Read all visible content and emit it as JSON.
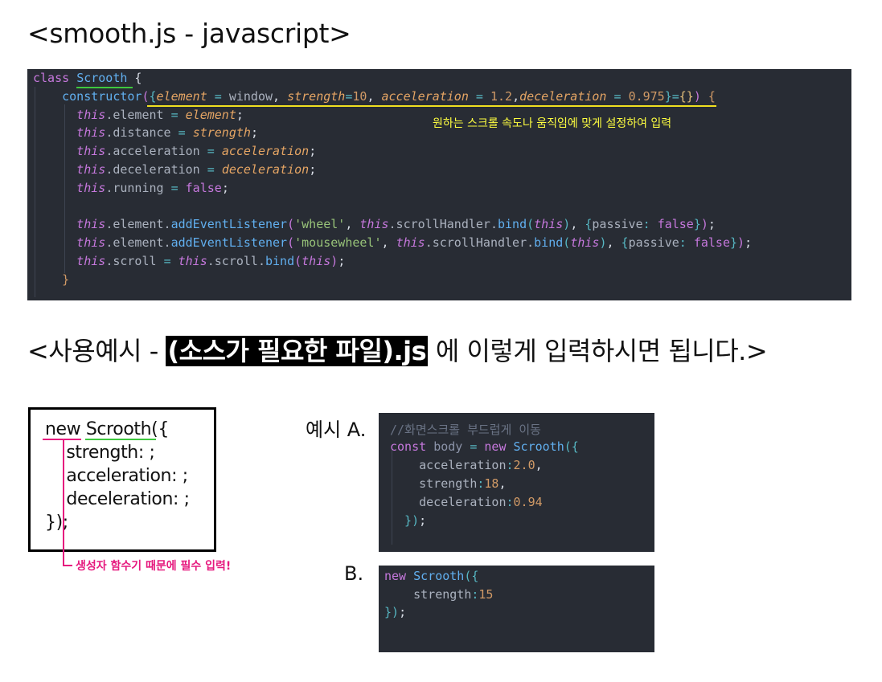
{
  "title": "<smooth.js - javascript>",
  "main_code": {
    "lines": [
      [
        {
          "t": "class ",
          "c": "kw"
        },
        {
          "t": "Scrooth",
          "c": "cls"
        },
        {
          "t": " {",
          "c": "white"
        }
      ],
      [
        {
          "t": "    constructor",
          "c": "fn"
        },
        {
          "t": "(",
          "c": "br2"
        },
        {
          "t": "{",
          "c": "br3"
        },
        {
          "t": "element",
          "c": "par"
        },
        {
          "t": " = ",
          "c": "op"
        },
        {
          "t": "window",
          "c": "prop"
        },
        {
          "t": ", ",
          "c": "white"
        },
        {
          "t": "strength",
          "c": "par"
        },
        {
          "t": "=",
          "c": "op"
        },
        {
          "t": "10",
          "c": "num"
        },
        {
          "t": ", ",
          "c": "white"
        },
        {
          "t": "acceleration",
          "c": "par"
        },
        {
          "t": " = ",
          "c": "op"
        },
        {
          "t": "1.2",
          "c": "num"
        },
        {
          "t": ",",
          "c": "white"
        },
        {
          "t": "deceleration",
          "c": "par"
        },
        {
          "t": " = ",
          "c": "op"
        },
        {
          "t": "0.975",
          "c": "num"
        },
        {
          "t": "}",
          "c": "br3"
        },
        {
          "t": "=",
          "c": "op"
        },
        {
          "t": "{}",
          "c": "bry"
        },
        {
          "t": ")",
          "c": "br2"
        },
        {
          "t": " {",
          "c": "br1"
        }
      ],
      [
        {
          "t": "      this",
          "c": "this"
        },
        {
          "t": ".element ",
          "c": "prop"
        },
        {
          "t": "= ",
          "c": "op"
        },
        {
          "t": "element",
          "c": "par"
        },
        {
          "t": ";",
          "c": "white"
        }
      ],
      [
        {
          "t": "      this",
          "c": "this"
        },
        {
          "t": ".distance ",
          "c": "prop"
        },
        {
          "t": "= ",
          "c": "op"
        },
        {
          "t": "strength",
          "c": "par"
        },
        {
          "t": ";",
          "c": "white"
        }
      ],
      [
        {
          "t": "      this",
          "c": "this"
        },
        {
          "t": ".acceleration ",
          "c": "prop"
        },
        {
          "t": "= ",
          "c": "op"
        },
        {
          "t": "acceleration",
          "c": "par"
        },
        {
          "t": ";",
          "c": "white"
        }
      ],
      [
        {
          "t": "      this",
          "c": "this"
        },
        {
          "t": ".deceleration ",
          "c": "prop"
        },
        {
          "t": "= ",
          "c": "op"
        },
        {
          "t": "deceleration",
          "c": "par"
        },
        {
          "t": ";",
          "c": "white"
        }
      ],
      [
        {
          "t": "      this",
          "c": "this"
        },
        {
          "t": ".running ",
          "c": "prop"
        },
        {
          "t": "= ",
          "c": "op"
        },
        {
          "t": "false",
          "c": "bool"
        },
        {
          "t": ";",
          "c": "white"
        }
      ],
      [
        {
          "t": "",
          "c": "white"
        }
      ],
      [
        {
          "t": "      this",
          "c": "this"
        },
        {
          "t": ".element.",
          "c": "prop"
        },
        {
          "t": "addEventListener",
          "c": "fn"
        },
        {
          "t": "(",
          "c": "br2"
        },
        {
          "t": "'wheel'",
          "c": "str"
        },
        {
          "t": ", ",
          "c": "white"
        },
        {
          "t": "this",
          "c": "this"
        },
        {
          "t": ".scrollHandler.",
          "c": "prop"
        },
        {
          "t": "bind",
          "c": "fn"
        },
        {
          "t": "(",
          "c": "br3"
        },
        {
          "t": "this",
          "c": "this"
        },
        {
          "t": ")",
          "c": "br3"
        },
        {
          "t": ", ",
          "c": "white"
        },
        {
          "t": "{",
          "c": "br3"
        },
        {
          "t": "passive",
          "c": "prop"
        },
        {
          "t": ": ",
          "c": "op"
        },
        {
          "t": "false",
          "c": "bool"
        },
        {
          "t": "}",
          "c": "br3"
        },
        {
          "t": ")",
          "c": "br2"
        },
        {
          "t": ";",
          "c": "white"
        }
      ],
      [
        {
          "t": "      this",
          "c": "this"
        },
        {
          "t": ".element.",
          "c": "prop"
        },
        {
          "t": "addEventListener",
          "c": "fn"
        },
        {
          "t": "(",
          "c": "br2"
        },
        {
          "t": "'mousewheel'",
          "c": "str"
        },
        {
          "t": ", ",
          "c": "white"
        },
        {
          "t": "this",
          "c": "this"
        },
        {
          "t": ".scrollHandler.",
          "c": "prop"
        },
        {
          "t": "bind",
          "c": "fn"
        },
        {
          "t": "(",
          "c": "br3"
        },
        {
          "t": "this",
          "c": "this"
        },
        {
          "t": ")",
          "c": "br3"
        },
        {
          "t": ", ",
          "c": "white"
        },
        {
          "t": "{",
          "c": "br3"
        },
        {
          "t": "passive",
          "c": "prop"
        },
        {
          "t": ": ",
          "c": "op"
        },
        {
          "t": "false",
          "c": "bool"
        },
        {
          "t": "}",
          "c": "br3"
        },
        {
          "t": ")",
          "c": "br2"
        },
        {
          "t": ";",
          "c": "white"
        }
      ],
      [
        {
          "t": "      this",
          "c": "this"
        },
        {
          "t": ".scroll ",
          "c": "prop"
        },
        {
          "t": "= ",
          "c": "op"
        },
        {
          "t": "this",
          "c": "this"
        },
        {
          "t": ".scroll.",
          "c": "prop"
        },
        {
          "t": "bind",
          "c": "fn"
        },
        {
          "t": "(",
          "c": "br2"
        },
        {
          "t": "this",
          "c": "this"
        },
        {
          "t": ")",
          "c": "br2"
        },
        {
          "t": ";",
          "c": "white"
        }
      ],
      [
        {
          "t": "    }",
          "c": "br1"
        }
      ]
    ]
  },
  "main_note": "원하는 스크롤 속도나 움직임에 맞게 설정하여 입력",
  "usage_heading": {
    "prefix": "<사용예시 - ",
    "highlight": "(소스가 필요한 파일).js",
    "suffix": " 에 이렇게 입력하시면 됩니다.>"
  },
  "constructor_box": {
    "lines": [
      "new Scrooth({",
      "    strength: ;",
      "    acceleration: ;",
      "    deceleration: ;",
      "});"
    ]
  },
  "constructor_note": "생성자 함수기 때문에 필수 입력!",
  "example_a": {
    "label": "예시 A.",
    "lines": [
      [
        {
          "t": "//화면스크롤 부드럽게 이동",
          "c": "cmt"
        }
      ],
      [
        {
          "t": "const ",
          "c": "kw"
        },
        {
          "t": "body ",
          "c": "var"
        },
        {
          "t": "= ",
          "c": "op"
        },
        {
          "t": "new ",
          "c": "kw"
        },
        {
          "t": "Scrooth",
          "c": "cls"
        },
        {
          "t": "({",
          "c": "br3"
        }
      ],
      [
        {
          "t": "    acceleration",
          "c": "prop"
        },
        {
          "t": ":",
          "c": "op"
        },
        {
          "t": "2.0",
          "c": "num"
        },
        {
          "t": ",",
          "c": "white"
        }
      ],
      [
        {
          "t": "    strength",
          "c": "prop"
        },
        {
          "t": ":",
          "c": "op"
        },
        {
          "t": "18",
          "c": "num"
        },
        {
          "t": ",",
          "c": "white"
        }
      ],
      [
        {
          "t": "    deceleration",
          "c": "prop"
        },
        {
          "t": ":",
          "c": "op"
        },
        {
          "t": "0.94",
          "c": "num"
        }
      ],
      [
        {
          "t": "  })",
          "c": "br3"
        },
        {
          "t": ";",
          "c": "white"
        }
      ]
    ]
  },
  "example_b": {
    "label": "B.",
    "lines": [
      [
        {
          "t": "new ",
          "c": "kw"
        },
        {
          "t": "Scrooth",
          "c": "cls"
        },
        {
          "t": "({",
          "c": "br3"
        }
      ],
      [
        {
          "t": "    strength",
          "c": "prop"
        },
        {
          "t": ":",
          "c": "op"
        },
        {
          "t": "15",
          "c": "num"
        }
      ],
      [
        {
          "t": "})",
          "c": "br3"
        },
        {
          "t": ";",
          "c": "white"
        }
      ]
    ]
  },
  "colors": {
    "underline_green": "#3ec83e",
    "underline_yellow": "#f0e020",
    "note_yellow": "#ffff40",
    "pink": "#e6197e",
    "code_bg": "#282c34"
  }
}
